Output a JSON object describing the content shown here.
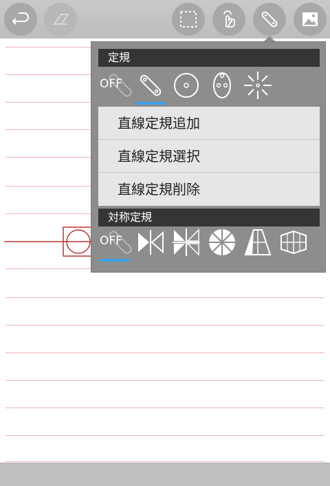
{
  "toolbar": {
    "buttons": [
      {
        "icon": "undo-icon",
        "enabled": true
      },
      {
        "icon": "eraser-icon",
        "enabled": false
      },
      {
        "icon": "selection-rect-icon",
        "enabled": true
      },
      {
        "icon": "touch-hand-icon",
        "enabled": true
      },
      {
        "icon": "ruler-icon",
        "enabled": true,
        "active": true
      },
      {
        "icon": "image-icon",
        "enabled": true
      }
    ]
  },
  "panel": {
    "rulers": {
      "header": "定規",
      "off_label": "OFF",
      "items": [
        "off",
        "line-ruler-icon",
        "circle-ruler-icon",
        "ellipse-ruler-icon",
        "radial-ruler-icon"
      ],
      "selected_index": 1
    },
    "menu": {
      "items": [
        {
          "label": "直線定規追加"
        },
        {
          "label": "直線定規選択"
        },
        {
          "label": "直線定規削除"
        }
      ]
    },
    "symmetry": {
      "header": "対称定規",
      "off_label": "OFF",
      "items": [
        "off",
        "mirror-vertical-icon",
        "mirror-quad-icon",
        "kaleidoscope-icon",
        "perspective-icon",
        "perspective-box-icon"
      ],
      "selected_index": 0
    }
  },
  "colors": {
    "toolbar_bg": "#bdbdbd",
    "button_bg": "#a8a8a8",
    "panel_bg": "#8d8d8d",
    "header_bg": "#353535",
    "menu_bg": "#e6e6e6",
    "accent_blue": "#3aa0e8",
    "rule_line": "#f0b3b3",
    "overlay_red": "#c03030"
  }
}
